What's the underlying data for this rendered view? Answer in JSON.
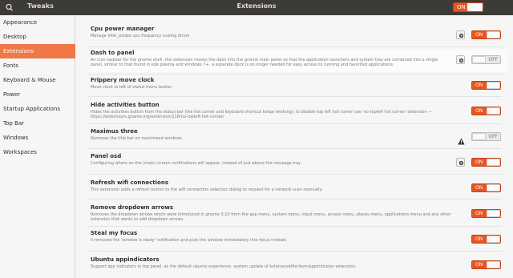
{
  "header": {
    "app_name": "Tweaks",
    "window_title": "Extensions",
    "global_toggle_label": "ON"
  },
  "sidebar": {
    "items": [
      {
        "label": "Appearance"
      },
      {
        "label": "Desktop"
      },
      {
        "label": "Extensions"
      },
      {
        "label": "Fonts"
      },
      {
        "label": "Keyboard & Mouse"
      },
      {
        "label": "Power"
      },
      {
        "label": "Startup Applications"
      },
      {
        "label": "Top Bar"
      },
      {
        "label": "Windows"
      },
      {
        "label": "Workspaces"
      }
    ],
    "selected": "Extensions"
  },
  "extensions": [
    {
      "title": "Cpu power manager",
      "desc": "Manage Intel_pstate cpu frequency scaling driver",
      "state": "ON",
      "has_settings": true,
      "warning": false
    },
    {
      "title": "Dash to panel",
      "desc": "An icon taskbar for the gnome shell. this extension moves the dash into the gnome main panel so that the application launchers and system tray are combined into a single panel, similar to that found in kde plasma and windows 7+. a separate dock is no longer needed for easy access to running and favorited applications.",
      "state": "OFF",
      "has_settings": true,
      "warning": false
    },
    {
      "title": "Frippery move clock",
      "desc": "Move clock to left of status menu button",
      "state": "ON",
      "has_settings": false,
      "warning": false
    },
    {
      "title": "Hide activities button",
      "desc": "Hides the activities button from the status bar (the hot corner and keyboard shortcut keeps working). to disable top left hot corner use 'no topleft hot corner' extension — https://extensions.gnome.org/extension/118/no-topleft-hot-corner/",
      "state": "ON",
      "has_settings": false,
      "warning": false
    },
    {
      "title": "Maximus three",
      "desc": "Removes the title bar on maximised windows.",
      "state": "OFF",
      "has_settings": false,
      "warning": true
    },
    {
      "title": "Panel osd",
      "desc": "Configuring where on the (main) screen notifications will appear, instead of just above the message tray",
      "state": "ON",
      "has_settings": true,
      "warning": false
    },
    {
      "title": "Refresh wifi connections",
      "desc": "This extension adds a refresh button to the wifi connection selection dialog to request for a network scan manually.",
      "state": "ON",
      "has_settings": false,
      "warning": false
    },
    {
      "title": "Remove dropdown arrows",
      "desc": "Removes the dropdown arrows which were introduced in gnome 3.10 from the app menu, system menu, input menu, access menu, places menu, applications menu and any other extension that wants to add dropdown arrows.",
      "state": "ON",
      "has_settings": false,
      "warning": false
    },
    {
      "title": "Steal my focus",
      "desc": "It removes the 'window is ready' notification and puts the window immediately into focus instead.",
      "state": "ON",
      "has_settings": false,
      "warning": false
    },
    {
      "title": "Ubuntu appindicators",
      "desc": "Support app indicators in top panel, as the default ubuntu experience. system update of kstatusnotifieritem/appindicator extension.",
      "state": "ON",
      "has_settings": false,
      "warning": false
    }
  ],
  "colors": {
    "accent": "#e95420",
    "titlebar": "#3c3b37"
  }
}
